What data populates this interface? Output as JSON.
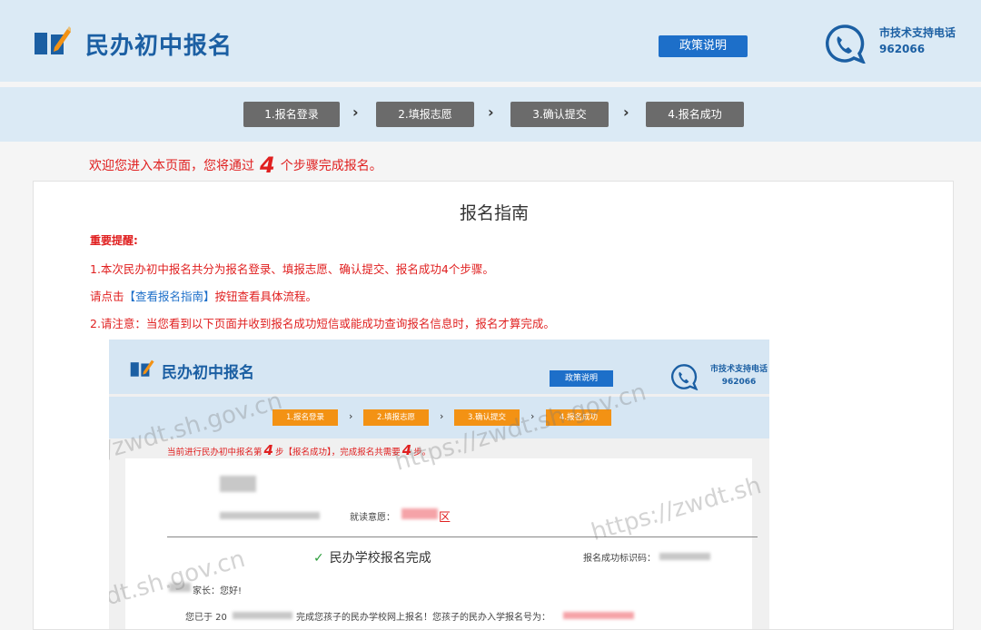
{
  "header": {
    "logo_text": "民办初中报名",
    "policy_button": "政策说明",
    "support_label": "市技术支持电话",
    "support_number": "962066"
  },
  "steps": [
    {
      "label": "1.报名登录"
    },
    {
      "label": "2.填报志愿"
    },
    {
      "label": "3.确认提交"
    },
    {
      "label": "4.报名成功"
    }
  ],
  "welcome": {
    "prefix": "欢迎您进入本页面，您将通过",
    "count": "4",
    "suffix": "个步骤完成报名。"
  },
  "guide": {
    "title": "报名指南",
    "reminder": "重要提醒:",
    "line1": "1.本次民办初中报名共分为报名登录、填报志愿、确认提交、报名成功4个步骤。",
    "line2_prefix": "请点击",
    "line2_link": "【查看报名指南】",
    "line2_suffix": "按钮查看具体流程。",
    "line3": "2.请注意：当您看到以下页面并收到报名成功短信或能成功查询报名信息时，报名才算完成。"
  },
  "screenshot": {
    "logo_text": "民办初中报名",
    "policy_button": "政策说明",
    "support_label": "市技术支持电话",
    "support_number": "962066",
    "steps": [
      "1.报名登录",
      "2.填报志愿",
      "3.确认提交",
      "4.报名成功"
    ],
    "current_prefix": "当前进行民办初中报名第",
    "current_step": "4",
    "current_middle": "步【报名成功】，完成报名共需要",
    "current_total": "4",
    "current_suffix": "步。",
    "choice_label": "就读意愿：",
    "choice_value": "区",
    "done_title": "民办学校报名完成",
    "id_label": "报名成功标识码：",
    "greeting": "家长：您好!",
    "message_prefix": "您已于 20",
    "message_body": "完成您孩子的民办学校网上报名！您孩子的民办入学报名号为："
  },
  "watermarks": [
    "/zwdt.sh.gov.cn",
    "https://zwdt.sh.gov.cn",
    "https://zwdt.sh",
    "dt.sh.gov.cn"
  ],
  "colors": {
    "header_bg": "#dbeaf5",
    "brand_blue": "#1b5fa3",
    "button_blue": "#1d6fc9",
    "step_grey": "#6b6b6b",
    "step_orange": "#f39214",
    "alert_red": "#e02020"
  }
}
